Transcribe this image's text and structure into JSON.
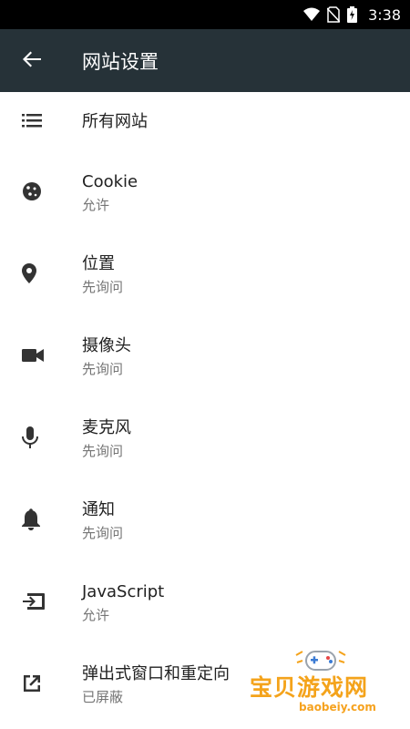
{
  "status_bar": {
    "time": "3:38",
    "icons": [
      "wifi-icon",
      "no-sim-icon",
      "battery-charging-icon"
    ]
  },
  "toolbar": {
    "title": "网站设置",
    "back_icon": "arrow-back-icon"
  },
  "list": {
    "all_sites": {
      "title": "所有网站",
      "icon": "list-icon"
    },
    "items": [
      {
        "title": "Cookie",
        "subtitle": "允许",
        "icon": "cookie-icon"
      },
      {
        "title": "位置",
        "subtitle": "先询问",
        "icon": "location-pin-icon"
      },
      {
        "title": "摄像头",
        "subtitle": "先询问",
        "icon": "videocam-icon"
      },
      {
        "title": "麦克风",
        "subtitle": "先询问",
        "icon": "microphone-icon"
      },
      {
        "title": "通知",
        "subtitle": "先询问",
        "icon": "bell-icon"
      },
      {
        "title": "JavaScript",
        "subtitle": "允许",
        "icon": "input-arrow-icon"
      },
      {
        "title": "弹出式窗口和重定向",
        "subtitle": "已屏蔽",
        "icon": "open-in-new-icon"
      }
    ]
  },
  "watermark": {
    "text": "宝贝游戏网",
    "url": "baobeiy.com",
    "icon": "gamepad-logo-icon"
  },
  "colors": {
    "toolbar": "#263238",
    "status_bar": "#000000",
    "icon": "#333333",
    "title": "#212121",
    "subtitle": "#757575",
    "watermark": "#f4a31b"
  }
}
